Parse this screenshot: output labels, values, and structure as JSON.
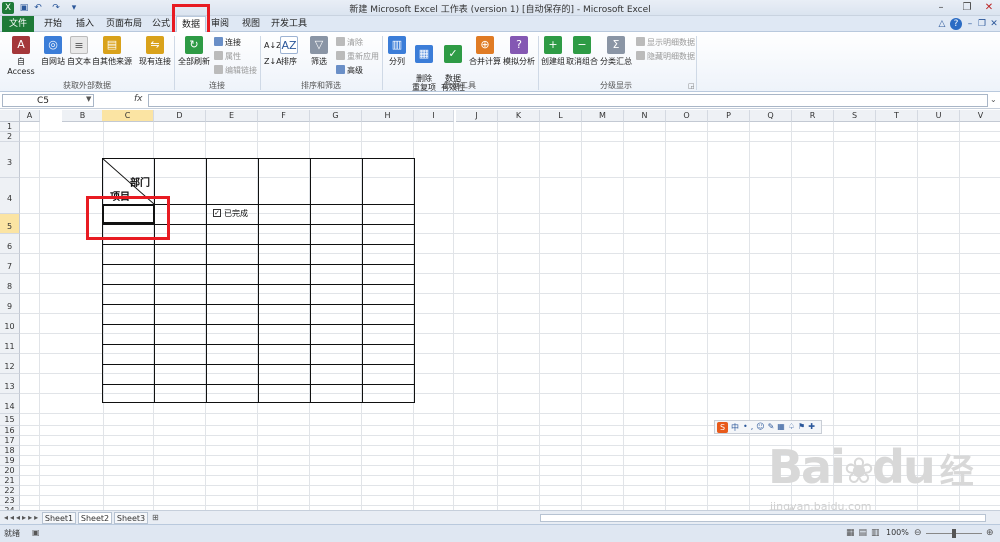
{
  "window": {
    "title": "新建 Microsoft Excel 工作表 (version 1) [自动保存的] - Microsoft Excel"
  },
  "quick_access": {
    "icons": [
      "excel-logo-icon",
      "save-icon",
      "undo-icon",
      "redo-icon",
      "customize-icon"
    ]
  },
  "tabs": [
    {
      "label": "文件"
    },
    {
      "label": "开始"
    },
    {
      "label": "插入"
    },
    {
      "label": "页面布局"
    },
    {
      "label": "公式"
    },
    {
      "label": "数据"
    },
    {
      "label": "审阅"
    },
    {
      "label": "视图"
    },
    {
      "label": "开发工具"
    }
  ],
  "active_tab": "数据",
  "ribbon": {
    "get_external": {
      "label": "获取外部数据",
      "buttons": [
        "自 Access",
        "自网站",
        "自文本",
        "自其他来源",
        "现有连接"
      ]
    },
    "connections": {
      "label": "连接",
      "refresh": "全部刷新",
      "items": [
        "连接",
        "属性",
        "编辑链接"
      ]
    },
    "sort_filter": {
      "label": "排序和筛选",
      "sort": "排序",
      "filter": "筛选",
      "items": [
        "清除",
        "重新应用",
        "高级"
      ]
    },
    "data_tools": {
      "label": "数据工具",
      "buttons": [
        "分列",
        "删除\n重复项",
        "数据\n有效性",
        "合并计算",
        "模拟分析"
      ]
    },
    "outline": {
      "label": "分级显示",
      "buttons": [
        "创建组",
        "取消组合",
        "分类汇总"
      ],
      "items": [
        "显示明细数据",
        "隐藏明细数据"
      ]
    }
  },
  "formula_bar": {
    "name_box": "C5",
    "fx": "fx",
    "formula": ""
  },
  "columns": [
    "A",
    "B",
    "C",
    "D",
    "E",
    "F",
    "G",
    "H",
    "I",
    "J",
    "K",
    "L",
    "M",
    "N",
    "O",
    "P",
    "Q",
    "R",
    "S",
    "T",
    "U",
    "V"
  ],
  "selected_column": "C",
  "rows": [
    "1",
    "2",
    "3",
    "4",
    "5",
    "6",
    "7",
    "8",
    "9",
    "10",
    "11",
    "12",
    "13",
    "14",
    "15",
    "16",
    "17",
    "18",
    "19",
    "20",
    "21",
    "22",
    "23",
    "24"
  ],
  "selected_row": "5",
  "cells": {
    "diag_top": "部门",
    "diag_bottom": "项目",
    "checkbox_label": "已完成",
    "checkbox_checked": true
  },
  "ime_toolbar": {
    "logo": "S",
    "lang": "中"
  },
  "sheets": [
    {
      "label": "Sheet1"
    },
    {
      "label": "Sheet2"
    },
    {
      "label": "Sheet3"
    }
  ],
  "status": {
    "ready": "就绪",
    "zoom": "100%"
  },
  "watermark": {
    "brand": "Bai",
    "brand2": "du",
    "cn": "经验",
    "url": "jingyan.baidu.com"
  }
}
